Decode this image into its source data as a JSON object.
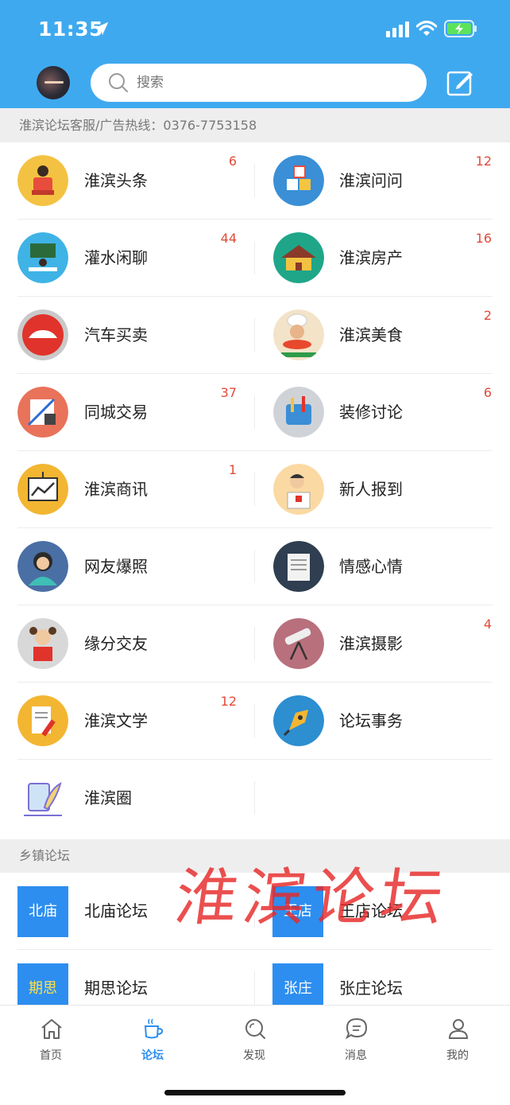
{
  "status_bar": {
    "time": "11:35"
  },
  "search": {
    "placeholder": "搜索"
  },
  "service_line": "淮滨论坛客服/广告热线：0376-7753158",
  "forums": [
    {
      "name": "淮滨头条",
      "count": "6",
      "icon": "reading-person-icon"
    },
    {
      "name": "淮滨问问",
      "count": "12",
      "icon": "number-blocks-icon"
    },
    {
      "name": "灌水闲聊",
      "count": "44",
      "icon": "classroom-icon"
    },
    {
      "name": "淮滨房产",
      "count": "16",
      "icon": "house-icon"
    },
    {
      "name": "汽车买卖",
      "count": "",
      "icon": "car-icon"
    },
    {
      "name": "淮滨美食",
      "count": "2",
      "icon": "chef-icon"
    },
    {
      "name": "同城交易",
      "count": "37",
      "icon": "stationery-icon"
    },
    {
      "name": "装修讨论",
      "count": "6",
      "icon": "tools-bag-icon"
    },
    {
      "name": "淮滨商讯",
      "count": "1",
      "icon": "presentation-board-icon"
    },
    {
      "name": "新人报到",
      "count": "",
      "icon": "newcomer-icon"
    },
    {
      "name": "网友爆照",
      "count": "",
      "icon": "woman-avatar-icon"
    },
    {
      "name": "情感心情",
      "count": "",
      "icon": "notepad-icon"
    },
    {
      "name": "缘分交友",
      "count": "",
      "icon": "girl-reading-icon"
    },
    {
      "name": "淮滨摄影",
      "count": "4",
      "icon": "telescope-icon"
    },
    {
      "name": "淮滨文学",
      "count": "12",
      "icon": "pencil-paper-icon"
    },
    {
      "name": "论坛事务",
      "count": "",
      "icon": "fountain-pen-icon"
    },
    {
      "name": "淮滨圈",
      "count": "",
      "icon": "feather-pen-icon"
    }
  ],
  "town_section": {
    "title": "乡镇论坛"
  },
  "towns": [
    {
      "badge": "北庙",
      "name": "北庙论坛"
    },
    {
      "badge": "王店",
      "name": "王店论坛"
    },
    {
      "badge": "期思",
      "name": "期思论坛"
    },
    {
      "badge": "张庄",
      "name": "张庄论坛"
    }
  ],
  "watermark": "淮滨论坛",
  "tabs": [
    {
      "label": "首页",
      "icon": "home-icon"
    },
    {
      "label": "论坛",
      "icon": "coffee-cup-icon",
      "active": true
    },
    {
      "label": "发现",
      "icon": "discover-search-icon"
    },
    {
      "label": "消息",
      "icon": "chat-bubble-icon"
    },
    {
      "label": "我的",
      "icon": "user-icon"
    }
  ],
  "colors": {
    "header": "#3fa9ef",
    "accent": "#2d8ef0",
    "badge_count": "#e04b3a"
  }
}
